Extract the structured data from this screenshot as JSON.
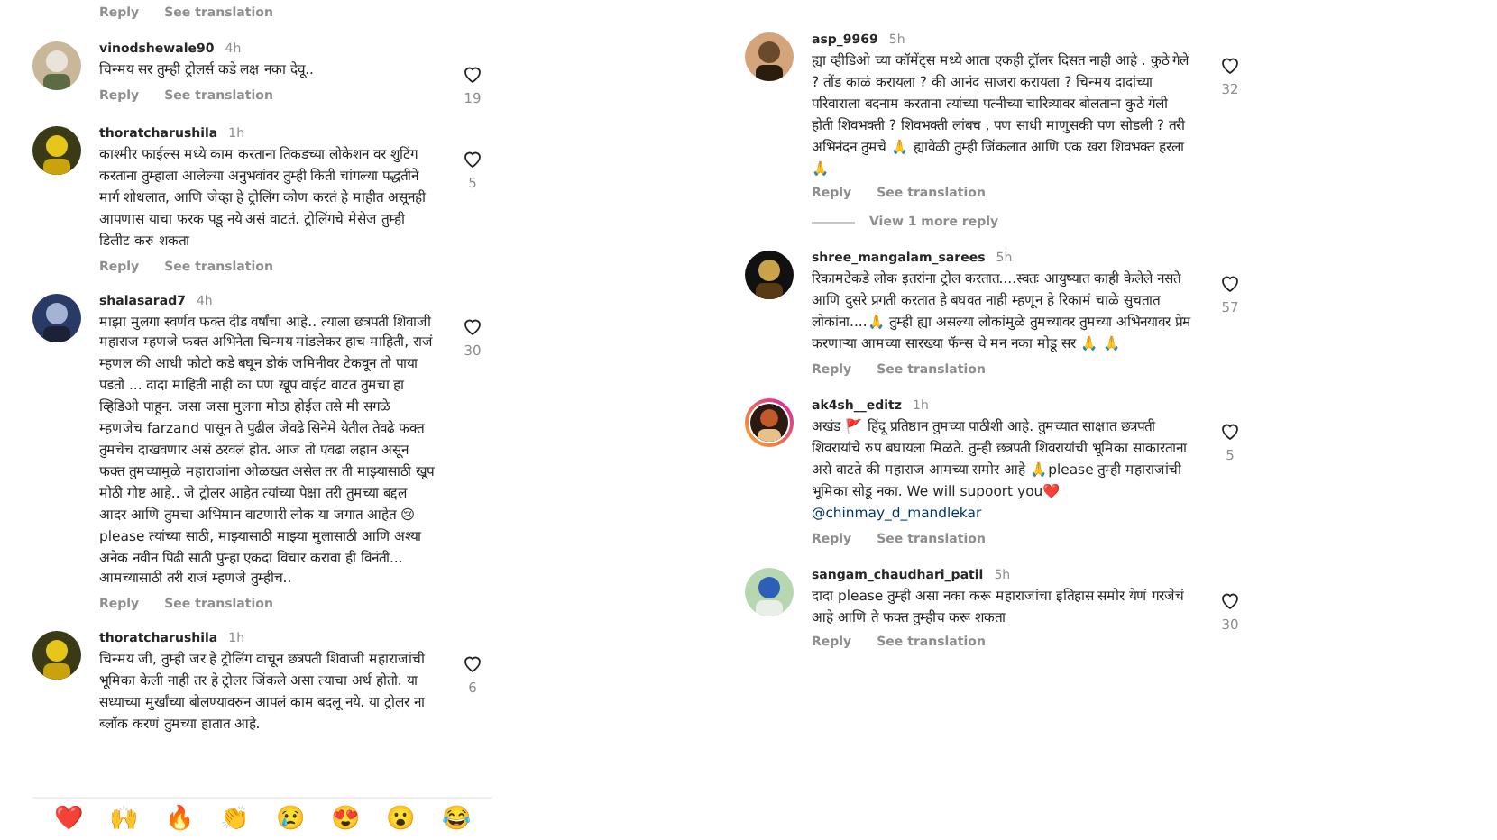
{
  "left_column": {
    "top_actions": {
      "reply": "Reply",
      "translate": "See translation"
    },
    "comments": [
      {
        "username": "vinodshewale90",
        "time": "4h",
        "text": "चिन्मय सर तुम्ही ट्रोलर्स कडे लक्ष नका देवू..",
        "likes": "19",
        "story_ring": false,
        "reply": "Reply",
        "translate": "See translation"
      },
      {
        "username": "thoratcharushila",
        "time": "1h",
        "text": "काश्मीर फाईल्स मध्ये काम करताना तिकडच्या लोकेशन वर शुटिंग करताना तुम्हाला आलेल्या अनुभवांवर तुम्ही किती चांगल्या पद्धतीने मार्ग शोधलात, आणि जेव्हा हे ट्रोलिंग कोण करतं हे माहीत असूनही आपणास याचा फरक पडू नये असं वाटतं. ट्रोलिंगचे मेसेज तुम्ही डिलीट करु शकता",
        "likes": "5",
        "story_ring": false,
        "reply": "Reply",
        "translate": "See translation"
      },
      {
        "username": "shalasarad7",
        "time": "4h",
        "text": "माझा मुलगा स्वर्णव फक्त दीड वर्षांचा आहे.. त्याला छत्रपती शिवाजी महाराज म्हणजे फक्त अभिनेता चिन्मय मांडलेकर हाच माहिती, राजं म्हणल की आधी फोटो कडे बघून डोकं जमिनीवर टेकवून तो पाया पडतो ... दादा माहिती नाही का पण खूप वाईट वाटत तुमचा हा व्हिडिओ पाहून. जसा जसा मुलगा मोठा होईल तसे मी सगळे म्हणजेच farzand पासून ते पुढील जेवढे सिनेमे येतील तेवढे फक्त तुमचेच दाखवणार असं ठरवलं होत. आज तो एवढा लहान असून फक्त तुमच्यामुळे महाराजांना ओळखत असेल तर ती माझ्यासाठी खूप मोठी गोष्ट आहे.. जे ट्रोलर आहेत त्यांच्या पेक्षा तरी तुमच्या बद्दल आदर आणि तुमचा अभिमान वाटणारी लोक या जगात आहेत 😢 please त्यांच्या साठी, माझ्यासाठी माझ्या मुलासाठी आणि अश्या अनेक नवीन पिढी साठी पुन्हा एकदा विचार करावा ही विनंती... आमच्यासाठी तरी राजं म्हणजे तुम्हीच..",
        "likes": "30",
        "story_ring": false,
        "reply": "Reply",
        "translate": "See translation"
      },
      {
        "username": "thoratcharushila",
        "time": "1h",
        "text": "चिन्मय जी, तुम्ही जर हे ट्रोलिंग वाचून छत्रपती शिवाजी महाराजांची भूमिका केली नाही तर हे ट्रोलर जिंकले असा त्याचा अर्थ होतो. या सध्याच्या मुर्खांच्या बोलण्यावरुन आपलं काम बदलू नये. या ट्रोलर ना ब्लॉक करणं तुमच्या हातात आहे.",
        "likes": "6",
        "story_ring": false
      }
    ],
    "reactions": [
      "❤️",
      "🙌",
      "🔥",
      "👏",
      "😢",
      "😍",
      "😮",
      "😂"
    ]
  },
  "right_column": {
    "comments": [
      {
        "username": "asp_9969",
        "time": "5h",
        "text": "ह्या व्हीडिओ च्या कॉमेंट्स मध्ये आता एकही ट्रॉलर दिसत नाही आहे . कुठे गेले ? तोंड काळं करायला ? की आनंद साजरा करायला ? चिन्मय दादांच्या परिवाराला बदनाम करताना त्यांच्या पत्नीच्या चारित्र्यावर बोलताना कुठे गेली होती शिवभक्ती ? शिवभक्ती लांबच , पण साधी माणुसकी पण सोडली ? तरी अभिनंदन तुमचे 🙏 ह्यावेळी तुम्ही जिंकलात आणि एक खरा शिवभक्त हरला 🙏",
        "likes": "32",
        "story_ring": false,
        "reply": "Reply",
        "translate": "See translation",
        "view_replies": "View 1 more reply"
      },
      {
        "username": "shree_mangalam_sarees",
        "time": "5h",
        "text": "रिकामटेकडे लोक इतरांना ट्रोल करतात....स्वतः आयुष्यात काही केलेले नसते आणि दुसरे प्रगती करतात हे बघवत नाही म्हणून हे रिकामं चाळे सुचतात लोकांना....🙏 तुम्ही ह्या असल्या लोकांमुळे तुमच्यावर तुमच्या अभिनयावर प्रेम करणाऱ्या आमच्या सारख्या फॅन्स चे मन नका मोडू सर 🙏 🙏",
        "likes": "57",
        "story_ring": false,
        "reply": "Reply",
        "translate": "See translation"
      },
      {
        "username": "ak4sh__editz",
        "time": "1h",
        "text": "अखंड 🚩 हिंदू प्रतिष्ठान तुमच्या पाठीशी आहे. तुमच्यात साक्षात छत्रपती शिवरायांचे रुप बघायला मिळते. तुम्ही छत्रपती शिवरायांची भूमिका साकारताना असे वाटते की महाराज आमच्या समोर आहे 🙏please तुम्ही महाराजांची भूमिका सोडू नका. We will supoort you❤️",
        "mention": "@chinmay_d_mandlekar",
        "likes": "5",
        "story_ring": true,
        "reply": "Reply",
        "translate": "See translation"
      },
      {
        "username": "sangam_chaudhari_patil",
        "time": "5h",
        "text": "दादा please तुम्ही असा नका करू महाराजांचा इतिहास समोर येणं गरजेचं आहे आणि ते फक्त तुम्हीच करू शकता",
        "likes": "30",
        "story_ring": false,
        "reply": "Reply",
        "translate": "See translation"
      }
    ]
  }
}
